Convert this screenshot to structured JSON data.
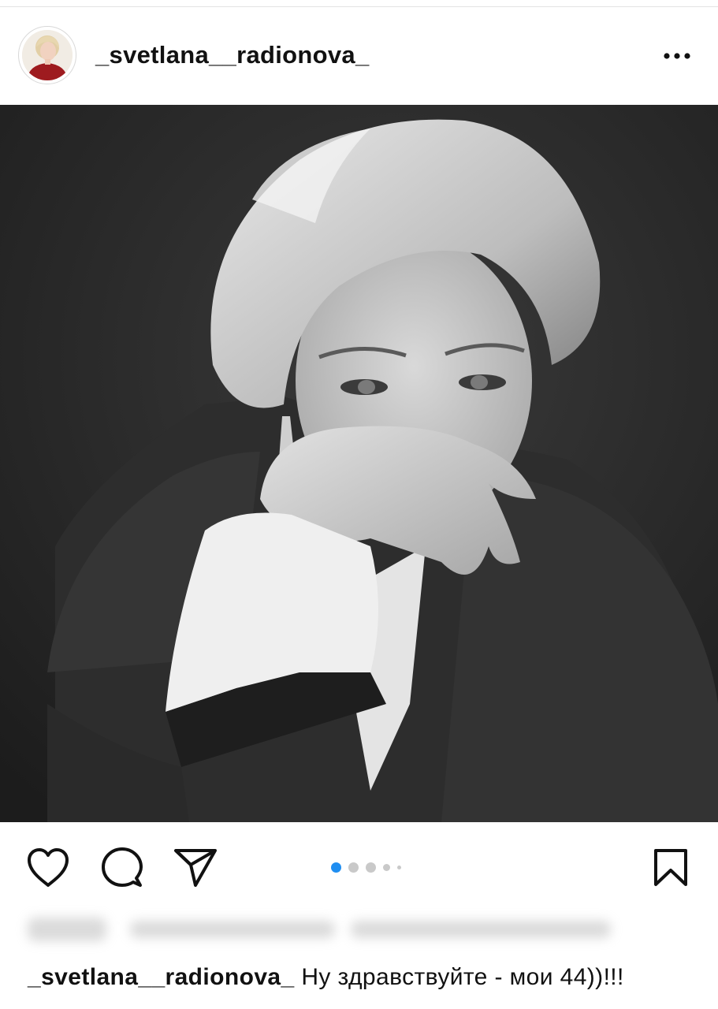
{
  "post": {
    "username": "_svetlana__radionova_",
    "more_icon": "more-horizontal-icon",
    "image": {
      "description_icon": "photo",
      "tone": "black-and-white"
    },
    "actions": {
      "like_icon": "heart-icon",
      "comment_icon": "comment-icon",
      "share_icon": "send-icon",
      "save_icon": "bookmark-icon"
    },
    "carousel": {
      "total": 5,
      "active_index": 0,
      "active_color": "#1f8ef1"
    },
    "caption": {
      "username": "_svetlana__radionova_",
      "text": "Ну здравствуйте - мои 44))!!!"
    }
  }
}
